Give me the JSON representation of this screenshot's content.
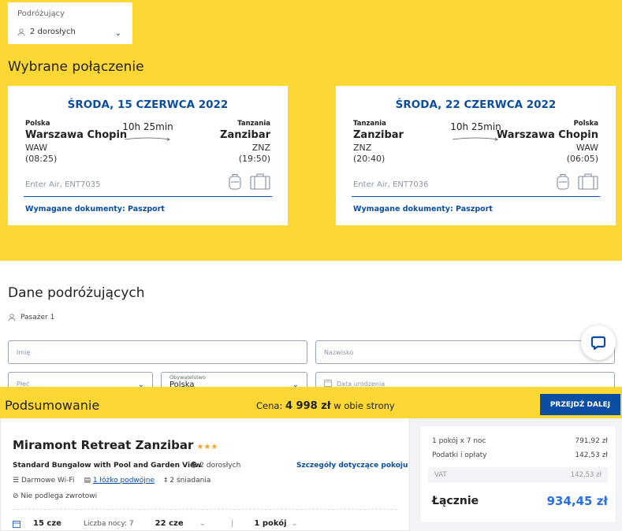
{
  "travelers": {
    "label": "Podróżujący",
    "value": "2 dorosłych"
  },
  "selected_connection": {
    "title": "Wybrane połączenie"
  },
  "flights": [
    {
      "date": "ŚRODA, 15 CZERWCA 2022",
      "from_country": "Polska",
      "from_city": "Warszawa Chopin",
      "from_code": "WAW",
      "from_time": "(08:25)",
      "duration": "10h 25min",
      "to_country": "Tanzania",
      "to_city": "Zanzibar",
      "to_code": "ZNZ",
      "to_time": "(19:50)",
      "carrier": "Enter Air, ENT7035",
      "docs": "Wymagane dokumenty: Paszport"
    },
    {
      "date": "ŚRODA, 22 CZERWCA 2022",
      "from_country": "Tanzania",
      "from_city": "Zanzibar",
      "from_code": "ZNZ",
      "from_time": "(20:40)",
      "duration": "10h 25min",
      "to_country": "Polska",
      "to_city": "Warszawa Chopin",
      "to_code": "WAW",
      "to_time": "(06:05)",
      "carrier": "Enter Air, ENT7036",
      "docs": "Wymagane dokumenty: Paszport"
    }
  ],
  "passengers": {
    "title": "Dane podróżujących",
    "passenger_label": "Pasażer 1",
    "first_name_placeholder": "Imię",
    "last_name_placeholder": "Nazwisko",
    "gender_placeholder": "Płeć",
    "citizenship_label": "Obywatelstwo",
    "citizenship_value": "Polska",
    "birthdate_placeholder": "Data urodzenia"
  },
  "summary": {
    "title": "Podsumowanie",
    "price_prefix": "Cena:",
    "price_value": "4 998 zł",
    "price_suffix": "w obie strony",
    "next_button": "PRZEJDŹ DALEJ"
  },
  "hotel": {
    "name": "Miramont Retreat Zanzibar",
    "stars": "★★★",
    "room_type": "Standard Bungalow with Pool and Garden View",
    "people": "2 dorosłych",
    "room_details_link": "Szczegóły dotyczące pokoju",
    "wifi": "Darmowe Wi-Fi",
    "bed": "1 łóżko podwójne",
    "breakfast": "2 śniadania",
    "refund": "Nie podlega zwrotowi",
    "check_in": "15 cze",
    "nights_label": "Liczba nocy: 7",
    "check_out": "22 cze",
    "rooms": "1 pokój"
  },
  "price_breakdown": {
    "rooms_label": "1 pokój x 7 noc",
    "rooms_value": "791,92 zł",
    "taxes_label": "Podatki i opłaty",
    "taxes_value": "142,53 zł",
    "vat_label": "VAT",
    "vat_value": "142,53 zł",
    "total_label": "Łącznie",
    "total_value": "934,45 zł"
  },
  "colors": {
    "brand_yellow": "#fdd835",
    "brand_blue": "#0a4ea3",
    "total_blue": "#2a6fdb"
  }
}
